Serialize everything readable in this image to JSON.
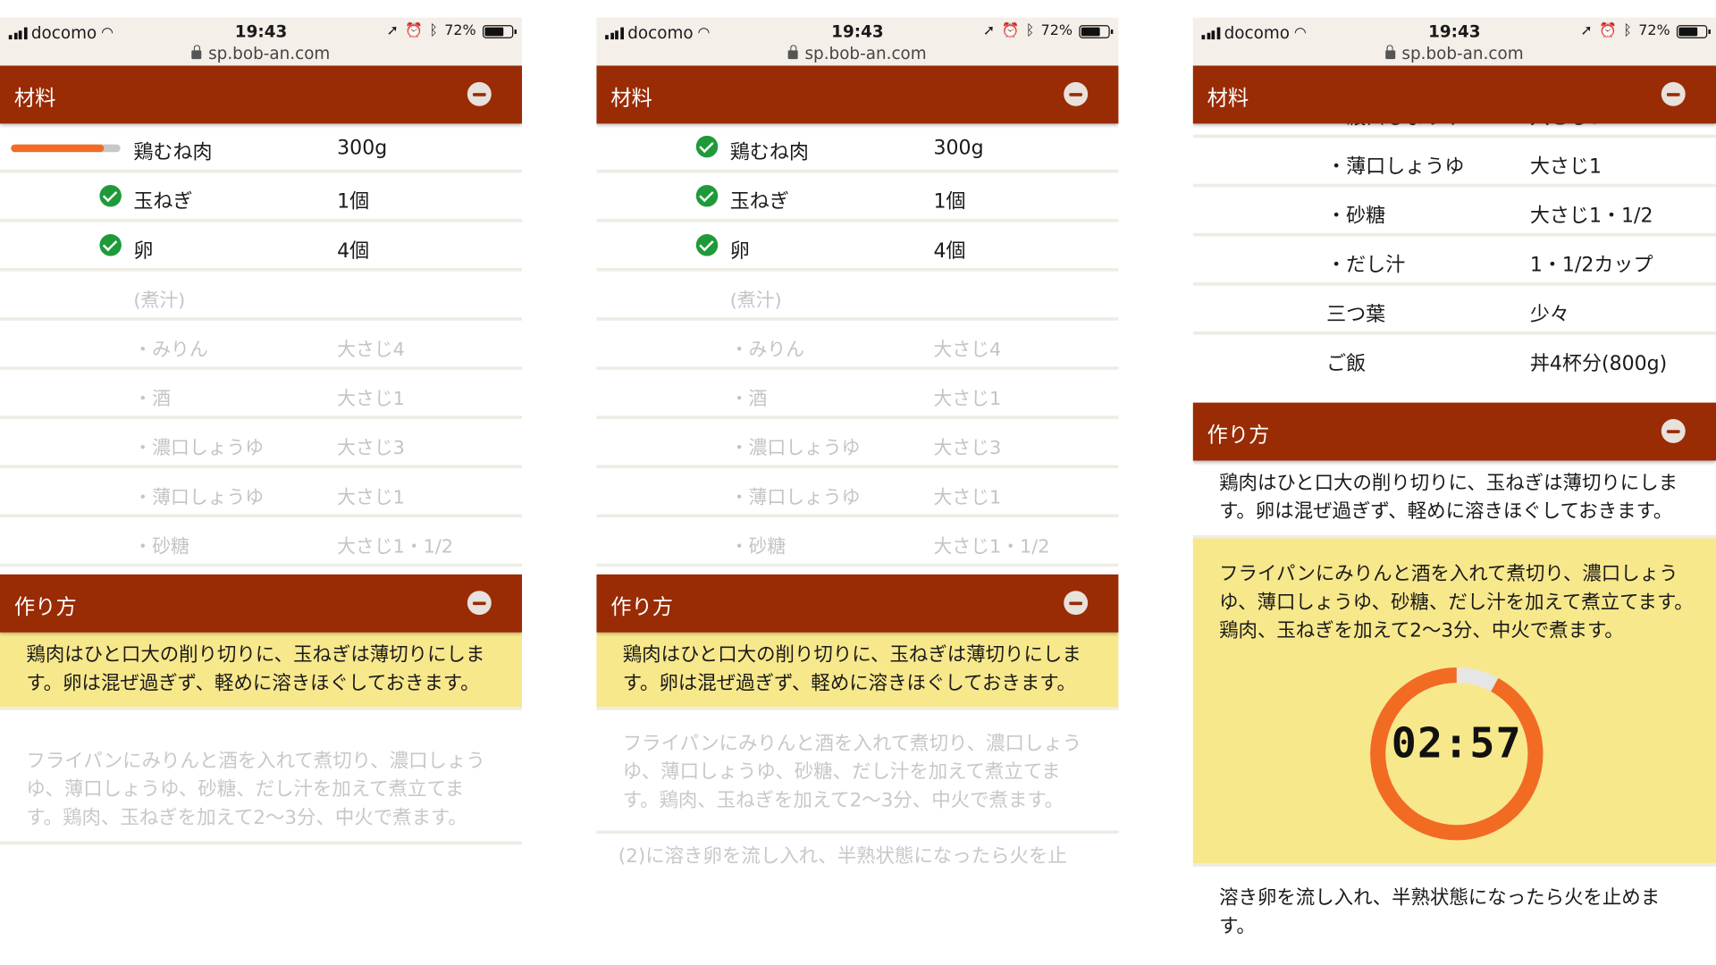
{
  "status": {
    "carrier": "docomo",
    "time": "19:43",
    "battery": "72%",
    "url": "sp.bob-an.com"
  },
  "sections": {
    "ingredients_title": "材料",
    "method_title": "作り方"
  },
  "ingredients": [
    {
      "name": "鶏むね肉",
      "amount": "300g"
    },
    {
      "name": "玉ねぎ",
      "amount": "1個"
    },
    {
      "name": "卵",
      "amount": "4個"
    },
    {
      "name": "(煮汁)",
      "amount": ""
    },
    {
      "name": "・みりん",
      "amount": "大さじ4"
    },
    {
      "name": "・酒",
      "amount": "大さじ1"
    },
    {
      "name": "・濃口しょうゆ",
      "amount": "大さじ3"
    },
    {
      "name": "・薄口しょうゆ",
      "amount": "大さじ1"
    },
    {
      "name": "・砂糖",
      "amount": "大さじ1・1/2"
    },
    {
      "name": "・だし汁",
      "amount": "1・1/2カップ"
    },
    {
      "name": "三つ葉",
      "amount": "少々"
    },
    {
      "name": "ご飯",
      "amount": "丼4杯分(800g)"
    }
  ],
  "progress_fraction": 0.85,
  "steps": [
    "鶏肉はひと口大の削り切りに、玉ねぎは薄切りにします。卵は混ぜ過ぎず、軽めに溶きほぐしておきます。",
    "フライパンにみりんと酒を入れて煮切り、濃口しょうゆ、薄口しょうゆ、砂糖、だし汁を加えて煮立てます。鶏肉、玉ねぎを加えて2〜3分、中火で煮ます。",
    "(2)に溶き卵を流し入れ、半熟状態になったら火を止",
    "溶き卵を流し入れ、半熟状態になったら火を止めます。"
  ],
  "timer": {
    "display": "02:57",
    "remaining_fraction": 0.92,
    "color": "#f26b22"
  },
  "colors": {
    "header": "#992b05",
    "active_step": "#f8e88c",
    "check": "#1f9a3a"
  }
}
